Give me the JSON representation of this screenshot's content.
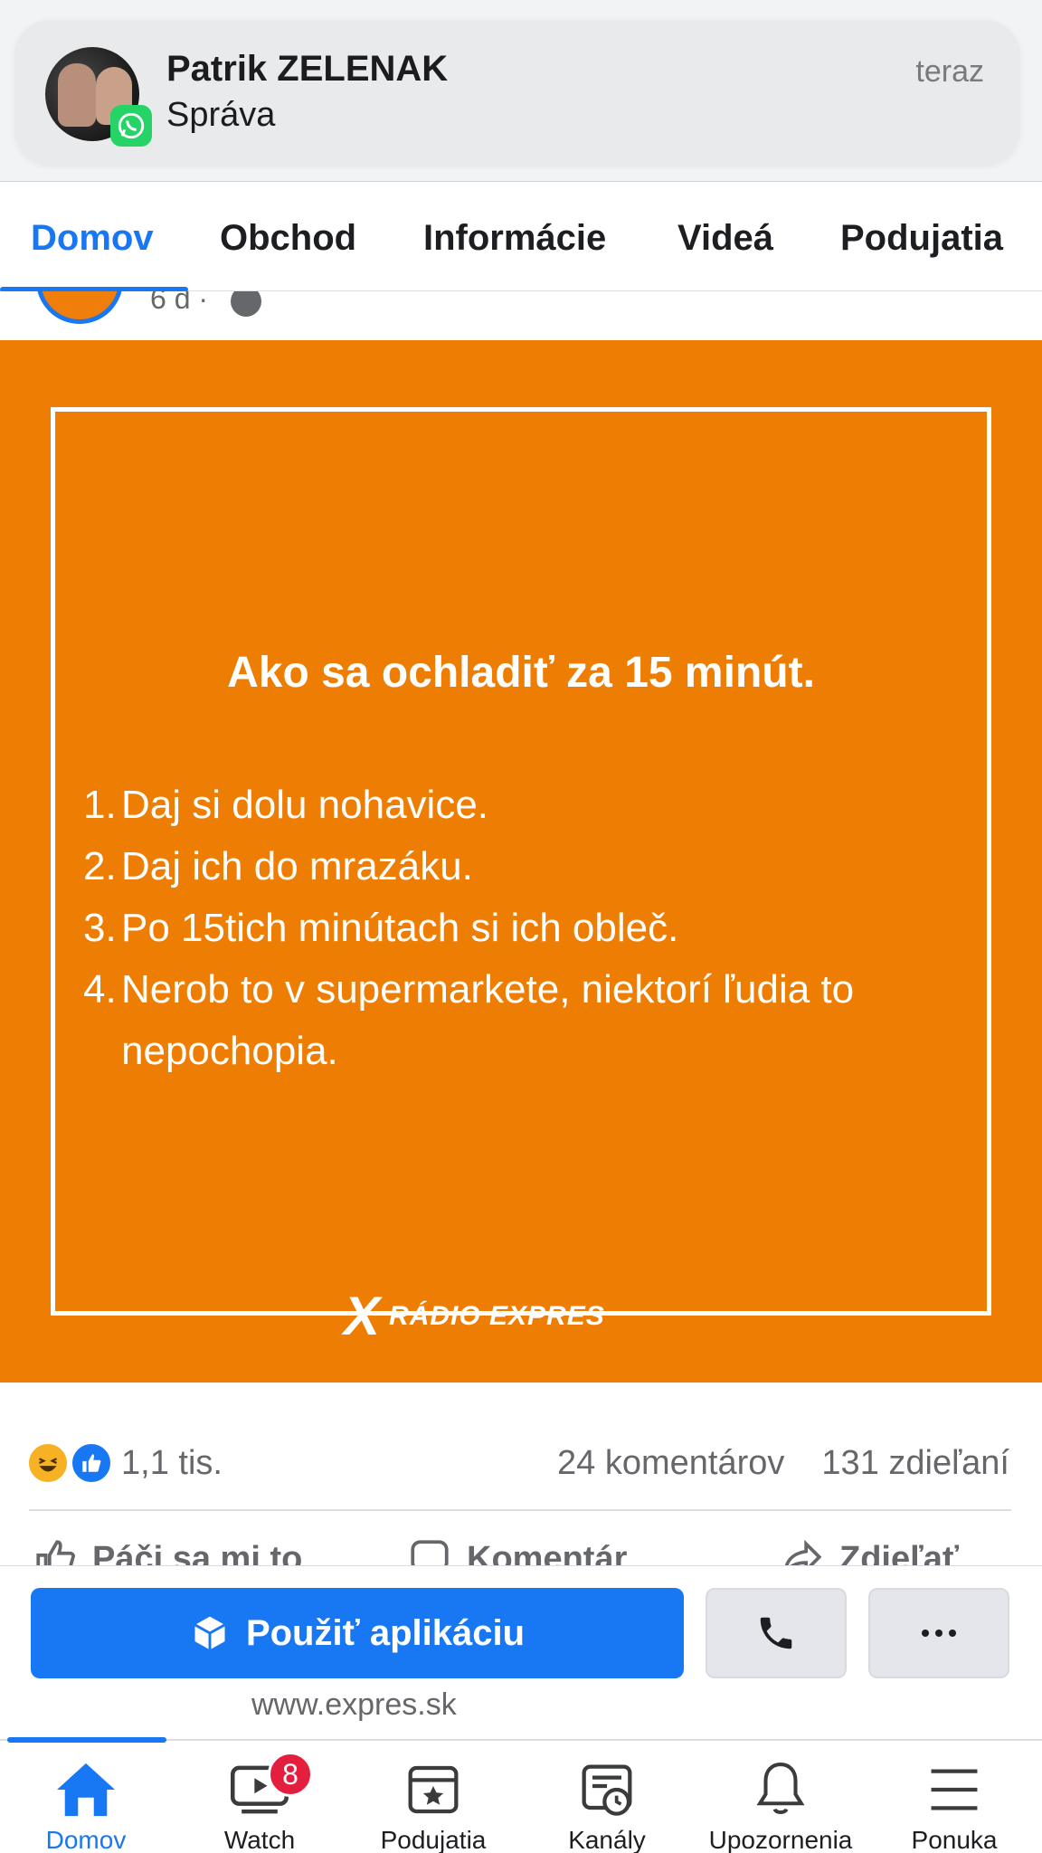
{
  "notification": {
    "sender": "Patrik ZELENAK",
    "subtitle": "Správa",
    "time": "teraz",
    "app_icon": "whatsapp-icon"
  },
  "tabs": [
    {
      "label": "Domov",
      "active": true
    },
    {
      "label": "Obchod",
      "active": false
    },
    {
      "label": "Informácie",
      "active": false
    },
    {
      "label": "Videá",
      "active": false
    },
    {
      "label": "Podujatia",
      "active": false
    }
  ],
  "post": {
    "time": "6 d ·",
    "image": {
      "heading": "Ako sa ochladiť za 15 minút.",
      "items": [
        {
          "num": "1.",
          "text": "Daj si dolu nohavice."
        },
        {
          "num": "2.",
          "text": "Daj ich do mrazáku."
        },
        {
          "num": "3.",
          "text": "Po 15tich minútach si ich obleč."
        },
        {
          "num": "4.",
          "text": "Nerob to v supermarkete, niektorí ľudia to nepochopia."
        }
      ],
      "brand_mark": "X",
      "brand_name": "RÁDIO EXPRES",
      "background": "#ee7e03"
    },
    "reactions_count": "1,1 tis.",
    "comments_count": "24 komentárov",
    "shares_count": "131 zdieľaní",
    "actions": {
      "like": "Páči sa mi to",
      "comment": "Komentár",
      "share": "Zdieľať"
    }
  },
  "app_banner": {
    "button_label": "Použiť aplikáciu",
    "url": "www.expres.sk"
  },
  "bottom_nav": [
    {
      "label": "Domov",
      "icon": "home-icon",
      "active": true
    },
    {
      "label": "Watch",
      "icon": "watch-icon",
      "badge": "8"
    },
    {
      "label": "Podujatia",
      "icon": "events-icon"
    },
    {
      "label": "Kanály",
      "icon": "feeds-icon"
    },
    {
      "label": "Upozornenia",
      "icon": "bell-icon"
    },
    {
      "label": "Ponuka",
      "icon": "menu-icon"
    }
  ],
  "colors": {
    "accent": "#1877f2",
    "badge": "#e41e3f",
    "whatsapp": "#25d366"
  }
}
